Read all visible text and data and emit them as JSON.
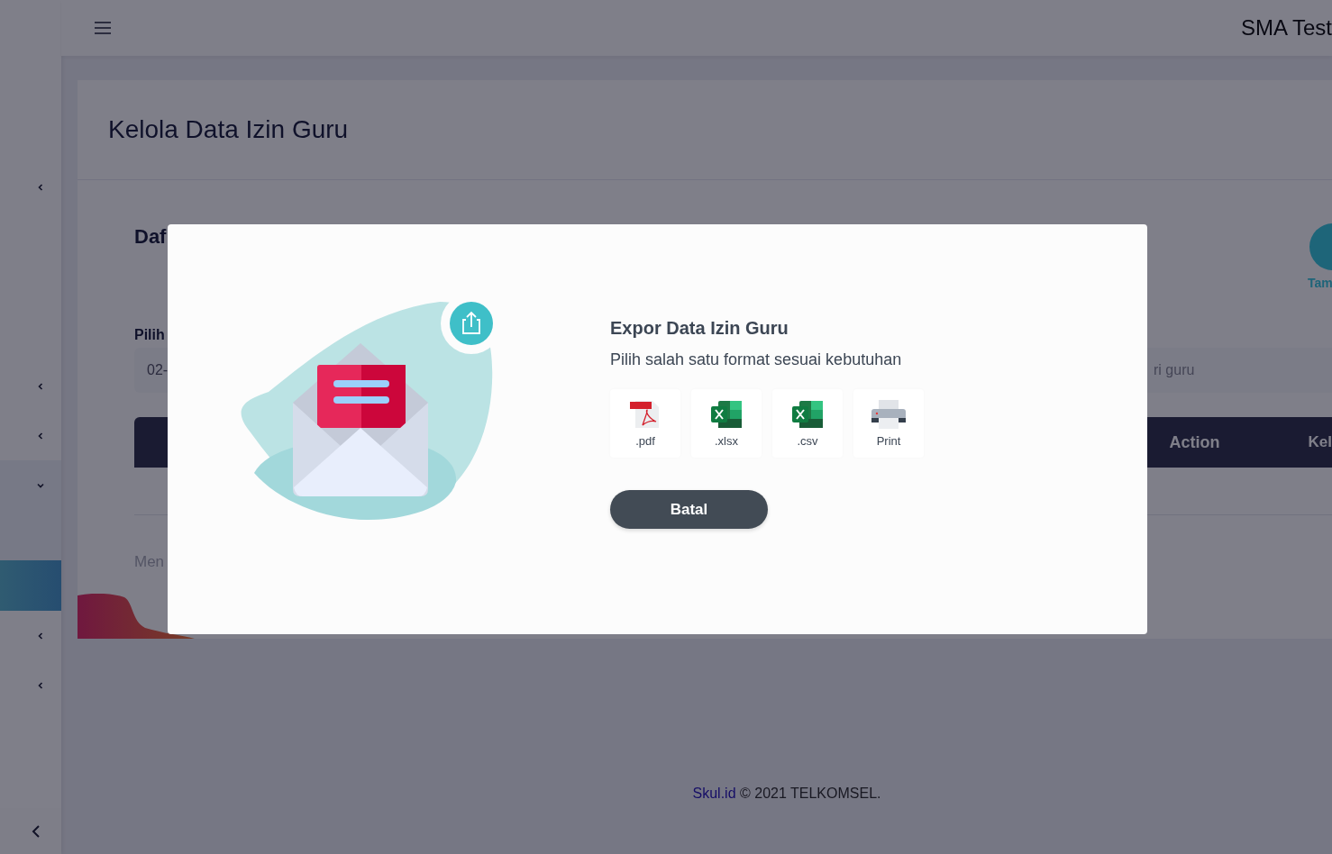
{
  "topbar": {
    "title": "SMA Test"
  },
  "sidebar": {
    "items": [
      {
        "expanded": false
      },
      {
        "expanded": false
      },
      {
        "expanded": false
      },
      {
        "expanded": true,
        "children": [
          {
            "selected": false
          },
          {
            "selected": true
          }
        ]
      },
      {
        "expanded": false
      },
      {
        "expanded": false
      }
    ]
  },
  "page": {
    "title": "Kelola Data Izin Guru",
    "section_title": "Daf",
    "add_button": "Tam",
    "filter_label": "Pilih",
    "date_field": {
      "value": "02-"
    },
    "search_field": {
      "placeholder": "ri guru"
    },
    "table": {
      "columns": [
        "Action",
        "Kel"
      ]
    },
    "info_text": "Men"
  },
  "modal": {
    "title": "Expor Data Izin Guru",
    "subtitle": "Pilih salah satu format sesuai kebutuhan",
    "options": [
      {
        "kind": "pdf",
        "label": ".pdf"
      },
      {
        "kind": "excel",
        "label": ".xlsx"
      },
      {
        "kind": "excel",
        "label": ".csv"
      },
      {
        "kind": "print",
        "label": "Print"
      }
    ],
    "cancel_button": "Batal"
  },
  "footer": {
    "link": "Skul.id",
    "text": "© 2021 TELKOMSEL."
  }
}
